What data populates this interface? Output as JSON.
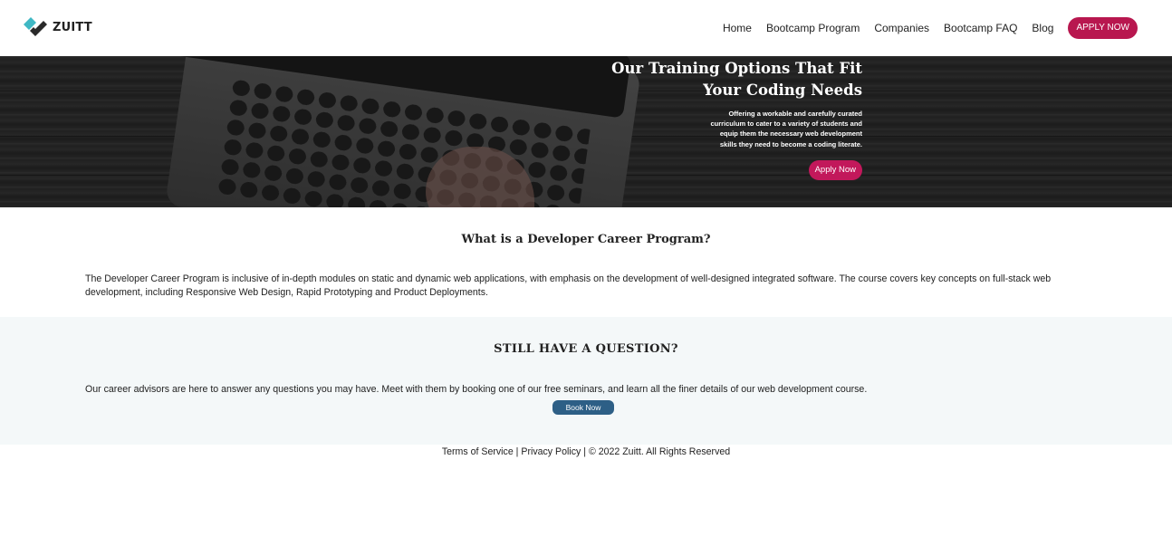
{
  "brand": {
    "name": "ZUITT",
    "icon": "zuitt-logo-icon",
    "colors": {
      "teal": "#3fb8c4",
      "dark": "#2a2a2a"
    }
  },
  "nav": {
    "links": [
      "Home",
      "Bootcamp Program",
      "Companies",
      "Bootcamp FAQ",
      "Blog"
    ],
    "apply_label": "APPLY NOW",
    "apply_color": "#b8174f"
  },
  "hero": {
    "title_line1": "Our Training Options That Fit",
    "title_line2": "Your Coding Needs",
    "subtitle": "Offering a workable and carefully curated curriculum to cater to a variety of students and equip them the necessary web development skills they need to become a coding literate.",
    "button_label": "Apply Now",
    "button_color": "#c2185b"
  },
  "program": {
    "title": "What is a Developer Career Program?",
    "body": "The Developer Career Program is inclusive of in-depth modules on static and dynamic web applications, with emphasis on the development of well-designed integrated software. The course covers key concepts on full-stack web development, including Responsive Web Design, Rapid Prototyping and Product Deployments."
  },
  "question": {
    "title": "STILL HAVE A QUESTION?",
    "body": "Our career advisors are here to answer any questions you may have. Meet with them by booking one of our free seminars, and learn all the finer details of our web development course.",
    "button_label": "Book Now",
    "button_color": "#2d5f86",
    "background": "#f4f8f9"
  },
  "footer": {
    "terms": "Terms of Service",
    "separator1": " | ",
    "privacy": "Privacy Policy",
    "separator2": " | ",
    "copyright": "© 2022 Zuitt. All Rights Reserved"
  }
}
